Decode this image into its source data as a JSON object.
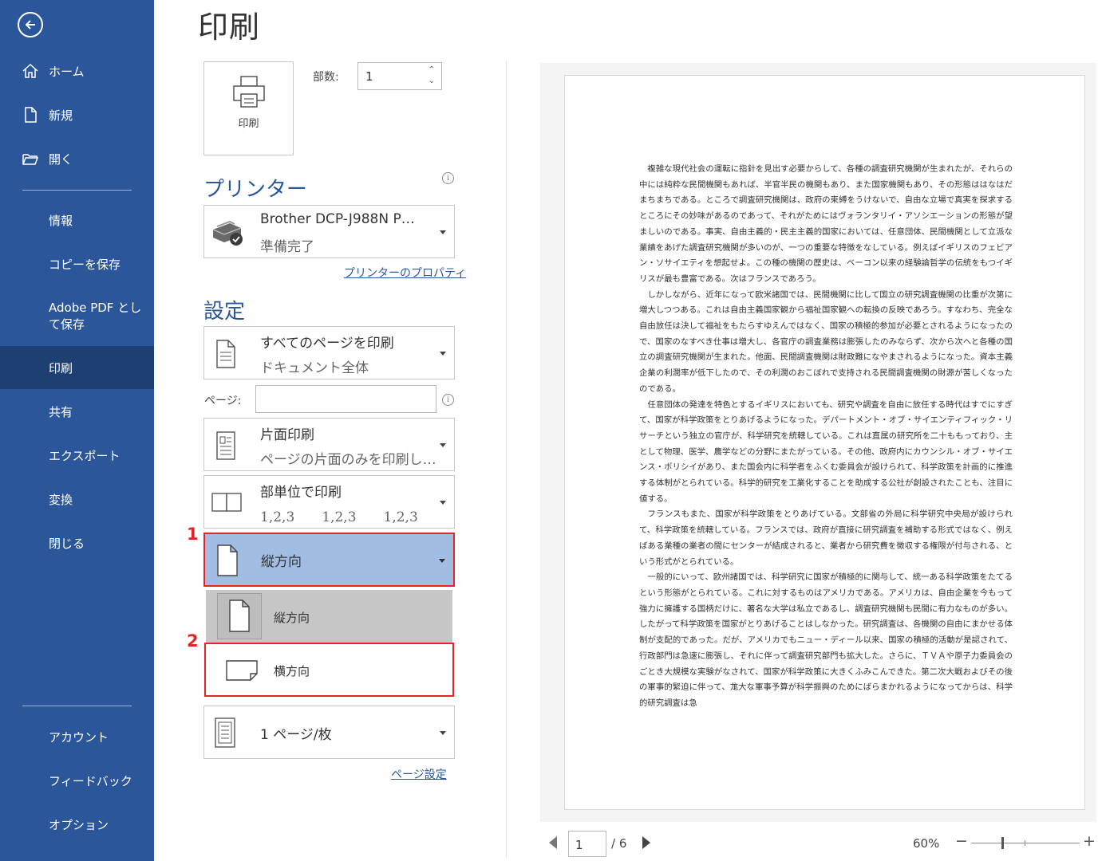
{
  "sidebar": {
    "items": [
      {
        "label": "ホーム"
      },
      {
        "label": "新規"
      },
      {
        "label": "開く"
      },
      {
        "label": "情報"
      },
      {
        "label": "コピーを保存"
      },
      {
        "label": "Adobe PDF として保存"
      },
      {
        "label": "印刷"
      },
      {
        "label": "共有"
      },
      {
        "label": "エクスポート"
      },
      {
        "label": "変換"
      },
      {
        "label": "閉じる"
      },
      {
        "label": "アカウント"
      },
      {
        "label": "フィードバック"
      },
      {
        "label": "オプション"
      }
    ],
    "active": "印刷",
    "accent_color": "#2b579a"
  },
  "title": "印刷",
  "print_button": {
    "label": "印刷"
  },
  "copies": {
    "label": "部数:",
    "value": "1"
  },
  "printer": {
    "section_title": "プリンター",
    "name": "Brother DCP-J988N P…",
    "status": "準備完了",
    "properties_link": "プリンターのプロパティ"
  },
  "settings": {
    "section_title": "設定",
    "pages_range": {
      "main": "すべてのページを印刷",
      "sub": "ドキュメント全体"
    },
    "pages_label": "ページ:",
    "pages_value": "",
    "sides": {
      "main": "片面印刷",
      "sub": "ページの片面のみを印刷し…"
    },
    "collate": {
      "main": "部単位で印刷",
      "sub": "1,2,3　　1,2,3　　1,2,3"
    },
    "orientation": {
      "selected": "縦方向",
      "options": [
        "縦方向",
        "横方向"
      ]
    },
    "pages_per_sheet": {
      "main": "1 ページ/枚"
    },
    "page_setup_link": "ページ設定"
  },
  "steps": [
    "1",
    "2"
  ],
  "preview": {
    "paragraphs": [
      "複雑な現代社会の運転に指針を見出す必要からして、各種の調査研究機関が生まれたが、それらの中には純粋な民間機関もあれば、半官半民の機関もあり、また国家機関もあり、その形態ははなはだまちまちである。ところで調査研究機関は、政府の束縛をうけないで、自由な立場で真実を探求するところにその妙味があるのであって、それがためにはヴォランタリイ・アソシエーションの形態が望ましいのである。事実、自由主義的・民主主義的国家においては、任意団体、民間機関として立派な業績をあげた調査研究機関が多いのが、一つの重要な特徴をなしている。例えばイギリスのフェビアン・ソサイエティを想起せよ。この種の機関の歴史は、ベーコン以来の経験論哲学の伝統をもつイギリスが最も豊富である。次はフランスであろう。",
      "しかしながら、近年になって欧米諸国では、民間機関に比して国立の研究調査機関の比重が次第に増大しつつある。これは自由主義国家観から福祉国家観への転換の反映であろう。すなわち、完全な自由放任は決して福祉をもたらすゆえんではなく、国家の積極的参加が必要とされるようになったので、国家のなすべき仕事は増大し、各官庁の調査業務は膨張したのみならず、次から次へと各種の国立の調査研究機関が生まれた。他面、民間調査機関は財政難になやまされるようになった。資本主義企業の利潤率が低下したので、その利潤のおこぼれで支持される民間調査機関の財源が苦しくなったのである。",
      "任意団体の発達を特色とするイギリスにおいても、研究や調査を自由に放任する時代はすでにすぎて、国家が科学政策をとりあげるようになった。デパートメント・オブ・サイエンティフィック・リサーチという独立の官庁が、科学研究を統轄している。これは直属の研究所を二十ももっており、主として物理、医学、農学などの分野にまたがっている。その他、政府内にカウンシル・オブ・サイエンス・ポリシイがあり、また国会内に科学者をふくむ委員会が設けられて、科学政策を計画的に推進する体制がとられている。科学的研究を工業化することを助成する公社が創設されたことも、注目に値する。",
      "フランスもまた、国家が科学政策をとりあげている。文部省の外局に科学研究中央局が設けられて、科学政策を統轄している。フランスでは、政府が直接に研究調査を補助する形式ではなく、例えばある業種の業者の間にセンターが結成されると、業者から研究費を徴収する権限が付与される、という形式がとられている。",
      "一般的にいって、欧州諸国では、科学研究に国家が積極的に関与して、統一ある科学政策をたてるという形態がとられている。これに対するものはアメリカである。アメリカは、自由企業を今もって強力に擁護する国柄だけに、著名な大学は私立であるし、調査研究機関も民間に有力なものが多い。したがって科学政策を国家がとりあげることはしなかった。研究調査は、各機関の自由にまかせる体制が支配的であった。だが、アメリカでもニュー・ディール以来、国家の積極的活動が是認されて、行政部門は急速に膨張し、それに伴って調査研究部門も拡大した。さらに、ＴＶＡや原子力委員会のごとき大規模な実験がなされて、国家が科学政策に大きくふみこんできた。第二次大戦およびその後の軍事的緊迫に伴って、尨大な軍事予算が科学振興のためにばらまかれるようになってからは、科学的研究調査は急"
    ]
  },
  "pager": {
    "current": "1",
    "total": "/ 6"
  },
  "zoom": {
    "percent": "60%",
    "minus": "−",
    "plus": "+"
  },
  "colors": {
    "sidebar": "#2b579a",
    "highlight": "#a2bde3",
    "callout": "#e52525"
  }
}
